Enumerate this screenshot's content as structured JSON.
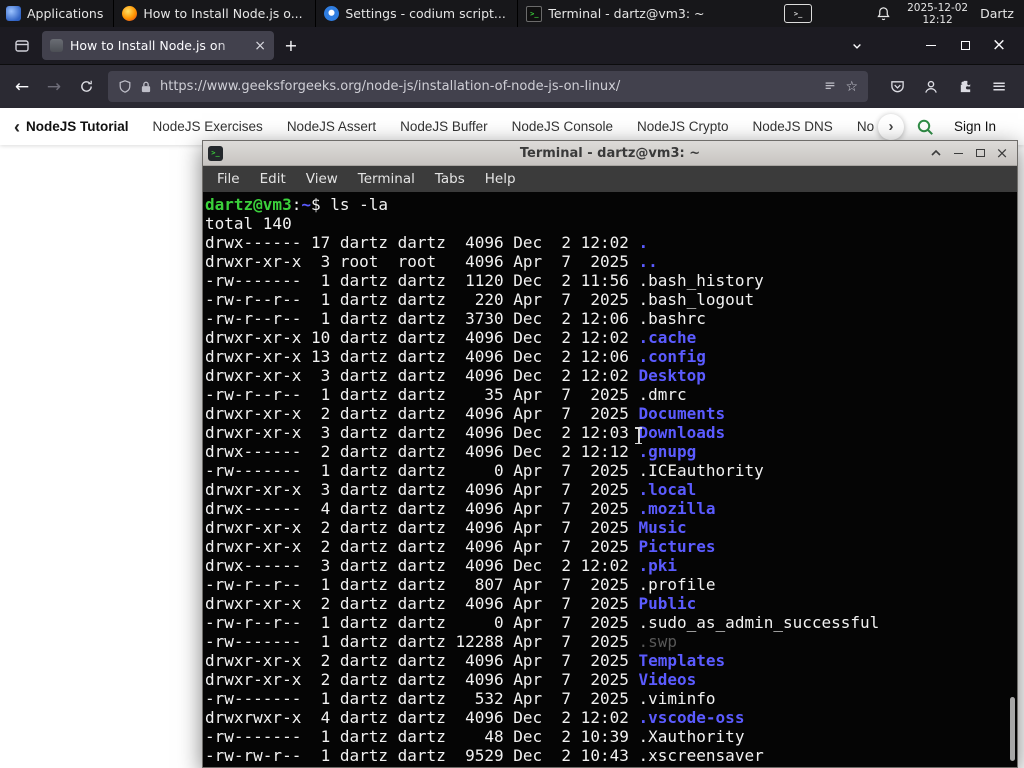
{
  "colors": {
    "dir_blue": "#5b5bff",
    "prompt_green": "#3bd13b",
    "dim_gray": "#585858",
    "gfg_green": "#2f8d46",
    "tabbar_bg": "#1c1b22",
    "navbar_bg": "#2b2a33",
    "urlbar_bg": "#42414d",
    "terminal_bg": "#050505"
  },
  "icons": {
    "back": "←",
    "forward": "→",
    "star": "☆",
    "menu": "≡",
    "close": "×",
    "plus": "+",
    "chevron_left": "‹",
    "chevron_right": "›",
    "terminal_glyph": ">_"
  },
  "taskbar": {
    "applications_label": "Applications",
    "windows": [
      {
        "title": "How to Install Node.js o..."
      },
      {
        "title": "Settings - codium script..."
      },
      {
        "title": "Terminal - dartz@vm3: ~"
      }
    ],
    "clock_date": "2025-12-02",
    "clock_time": "12:12",
    "user": "Dartz"
  },
  "browser": {
    "tab_title": "How to Install Node.js on",
    "url": "https://www.geeksforgeeks.org/node-js/installation-of-node-js-on-linux/"
  },
  "page_nav": {
    "primary": "NodeJS Tutorial",
    "items": [
      "NodeJS Exercises",
      "NodeJS Assert",
      "NodeJS Buffer",
      "NodeJS Console",
      "NodeJS Crypto",
      "NodeJS DNS",
      "Node"
    ],
    "sign_in": "Sign In"
  },
  "terminal": {
    "window_title": "Terminal - dartz@vm3: ~",
    "menu": [
      "File",
      "Edit",
      "View",
      "Terminal",
      "Tabs",
      "Help"
    ],
    "prompt_user_host": "dartz@vm3",
    "prompt_separator": ":",
    "prompt_path": "~",
    "prompt_symbol": "$",
    "command": " ls -la",
    "total_line": "total 140",
    "rows": [
      {
        "perms": "drwx------",
        "links": 17,
        "owner": "dartz",
        "group": "dartz",
        "size": 4096,
        "month": "Dec",
        "day": 2,
        "time": "12:02",
        "name": ".",
        "style": "dir"
      },
      {
        "perms": "drwxr-xr-x",
        "links": 3,
        "owner": "root",
        "group": "root",
        "size": 4096,
        "month": "Apr",
        "day": 7,
        "time": "2025",
        "name": "..",
        "style": "dir"
      },
      {
        "perms": "-rw-------",
        "links": 1,
        "owner": "dartz",
        "group": "dartz",
        "size": 1120,
        "month": "Dec",
        "day": 2,
        "time": "11:56",
        "name": ".bash_history"
      },
      {
        "perms": "-rw-r--r--",
        "links": 1,
        "owner": "dartz",
        "group": "dartz",
        "size": 220,
        "month": "Apr",
        "day": 7,
        "time": "2025",
        "name": ".bash_logout"
      },
      {
        "perms": "-rw-r--r--",
        "links": 1,
        "owner": "dartz",
        "group": "dartz",
        "size": 3730,
        "month": "Dec",
        "day": 2,
        "time": "12:06",
        "name": ".bashrc"
      },
      {
        "perms": "drwxr-xr-x",
        "links": 10,
        "owner": "dartz",
        "group": "dartz",
        "size": 4096,
        "month": "Dec",
        "day": 2,
        "time": "12:02",
        "name": ".cache",
        "style": "dir"
      },
      {
        "perms": "drwxr-xr-x",
        "links": 13,
        "owner": "dartz",
        "group": "dartz",
        "size": 4096,
        "month": "Dec",
        "day": 2,
        "time": "12:06",
        "name": ".config",
        "style": "dir"
      },
      {
        "perms": "drwxr-xr-x",
        "links": 3,
        "owner": "dartz",
        "group": "dartz",
        "size": 4096,
        "month": "Dec",
        "day": 2,
        "time": "12:02",
        "name": "Desktop",
        "style": "dir"
      },
      {
        "perms": "-rw-r--r--",
        "links": 1,
        "owner": "dartz",
        "group": "dartz",
        "size": 35,
        "month": "Apr",
        "day": 7,
        "time": "2025",
        "name": ".dmrc"
      },
      {
        "perms": "drwxr-xr-x",
        "links": 2,
        "owner": "dartz",
        "group": "dartz",
        "size": 4096,
        "month": "Apr",
        "day": 7,
        "time": "2025",
        "name": "Documents",
        "style": "dir"
      },
      {
        "perms": "drwxr-xr-x",
        "links": 3,
        "owner": "dartz",
        "group": "dartz",
        "size": 4096,
        "month": "Dec",
        "day": 2,
        "time": "12:03",
        "name": "Downloads",
        "style": "dir"
      },
      {
        "perms": "drwx------",
        "links": 2,
        "owner": "dartz",
        "group": "dartz",
        "size": 4096,
        "month": "Dec",
        "day": 2,
        "time": "12:12",
        "name": ".gnupg",
        "style": "dir"
      },
      {
        "perms": "-rw-------",
        "links": 1,
        "owner": "dartz",
        "group": "dartz",
        "size": 0,
        "month": "Apr",
        "day": 7,
        "time": "2025",
        "name": ".ICEauthority"
      },
      {
        "perms": "drwxr-xr-x",
        "links": 3,
        "owner": "dartz",
        "group": "dartz",
        "size": 4096,
        "month": "Apr",
        "day": 7,
        "time": "2025",
        "name": ".local",
        "style": "dir"
      },
      {
        "perms": "drwx------",
        "links": 4,
        "owner": "dartz",
        "group": "dartz",
        "size": 4096,
        "month": "Apr",
        "day": 7,
        "time": "2025",
        "name": ".mozilla",
        "style": "dir"
      },
      {
        "perms": "drwxr-xr-x",
        "links": 2,
        "owner": "dartz",
        "group": "dartz",
        "size": 4096,
        "month": "Apr",
        "day": 7,
        "time": "2025",
        "name": "Music",
        "style": "dir"
      },
      {
        "perms": "drwxr-xr-x",
        "links": 2,
        "owner": "dartz",
        "group": "dartz",
        "size": 4096,
        "month": "Apr",
        "day": 7,
        "time": "2025",
        "name": "Pictures",
        "style": "dir"
      },
      {
        "perms": "drwx------",
        "links": 3,
        "owner": "dartz",
        "group": "dartz",
        "size": 4096,
        "month": "Dec",
        "day": 2,
        "time": "12:02",
        "name": ".pki",
        "style": "dir"
      },
      {
        "perms": "-rw-r--r--",
        "links": 1,
        "owner": "dartz",
        "group": "dartz",
        "size": 807,
        "month": "Apr",
        "day": 7,
        "time": "2025",
        "name": ".profile"
      },
      {
        "perms": "drwxr-xr-x",
        "links": 2,
        "owner": "dartz",
        "group": "dartz",
        "size": 4096,
        "month": "Apr",
        "day": 7,
        "time": "2025",
        "name": "Public",
        "style": "dir"
      },
      {
        "perms": "-rw-r--r--",
        "links": 1,
        "owner": "dartz",
        "group": "dartz",
        "size": 0,
        "month": "Apr",
        "day": 7,
        "time": "2025",
        "name": ".sudo_as_admin_successful"
      },
      {
        "perms": "-rw-------",
        "links": 1,
        "owner": "dartz",
        "group": "dartz",
        "size": 12288,
        "month": "Apr",
        "day": 7,
        "time": "2025",
        "name": ".swp",
        "style": "dim"
      },
      {
        "perms": "drwxr-xr-x",
        "links": 2,
        "owner": "dartz",
        "group": "dartz",
        "size": 4096,
        "month": "Apr",
        "day": 7,
        "time": "2025",
        "name": "Templates",
        "style": "dir"
      },
      {
        "perms": "drwxr-xr-x",
        "links": 2,
        "owner": "dartz",
        "group": "dartz",
        "size": 4096,
        "month": "Apr",
        "day": 7,
        "time": "2025",
        "name": "Videos",
        "style": "dir"
      },
      {
        "perms": "-rw-------",
        "links": 1,
        "owner": "dartz",
        "group": "dartz",
        "size": 532,
        "month": "Apr",
        "day": 7,
        "time": "2025",
        "name": ".viminfo"
      },
      {
        "perms": "drwxrwxr-x",
        "links": 4,
        "owner": "dartz",
        "group": "dartz",
        "size": 4096,
        "month": "Dec",
        "day": 2,
        "time": "12:02",
        "name": ".vscode-oss",
        "style": "dir"
      },
      {
        "perms": "-rw-------",
        "links": 1,
        "owner": "dartz",
        "group": "dartz",
        "size": 48,
        "month": "Dec",
        "day": 2,
        "time": "10:39",
        "name": ".Xauthority"
      },
      {
        "perms": "-rw-rw-r--",
        "links": 1,
        "owner": "dartz",
        "group": "dartz",
        "size": 9529,
        "month": "Dec",
        "day": 2,
        "time": "10:43",
        "name": ".xscreensaver"
      }
    ]
  }
}
